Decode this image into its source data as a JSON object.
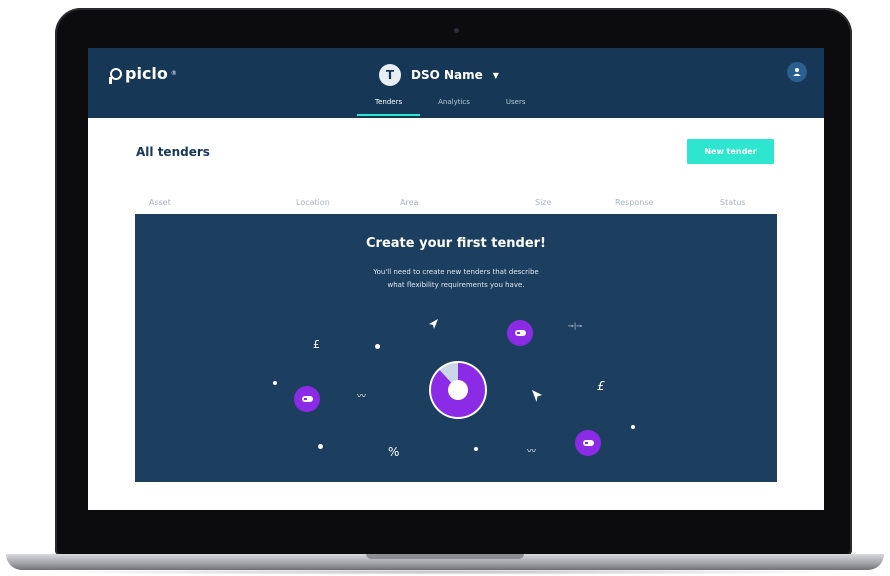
{
  "app": {
    "logo_text": "piclo",
    "logo_mark": "®",
    "org_initial": "T",
    "org_name": "DSO Name"
  },
  "tabs": [
    {
      "label": "Tenders",
      "active": true
    },
    {
      "label": "Analytics",
      "active": false
    },
    {
      "label": "Users",
      "active": false
    }
  ],
  "main": {
    "title": "All tenders",
    "new_button": "New tender",
    "columns": [
      "Asset",
      "Location",
      "Area",
      "Size",
      "Response",
      "Status"
    ]
  },
  "empty_state": {
    "title": "Create your first tender!",
    "description_line1": "You'll need to create new tenders that describe",
    "description_line2": "what flexibility requirements you have."
  },
  "illustration": {
    "symbols": {
      "pound": "£",
      "percent": "%",
      "sliders": "⊸|⊸",
      "trend": "〰"
    },
    "donut": {
      "filled_fraction": 0.88
    }
  },
  "colors": {
    "nav": "#163856",
    "accent": "#2ee5cf",
    "panel": "#1c3f5f",
    "purple": "#8b2be6"
  }
}
